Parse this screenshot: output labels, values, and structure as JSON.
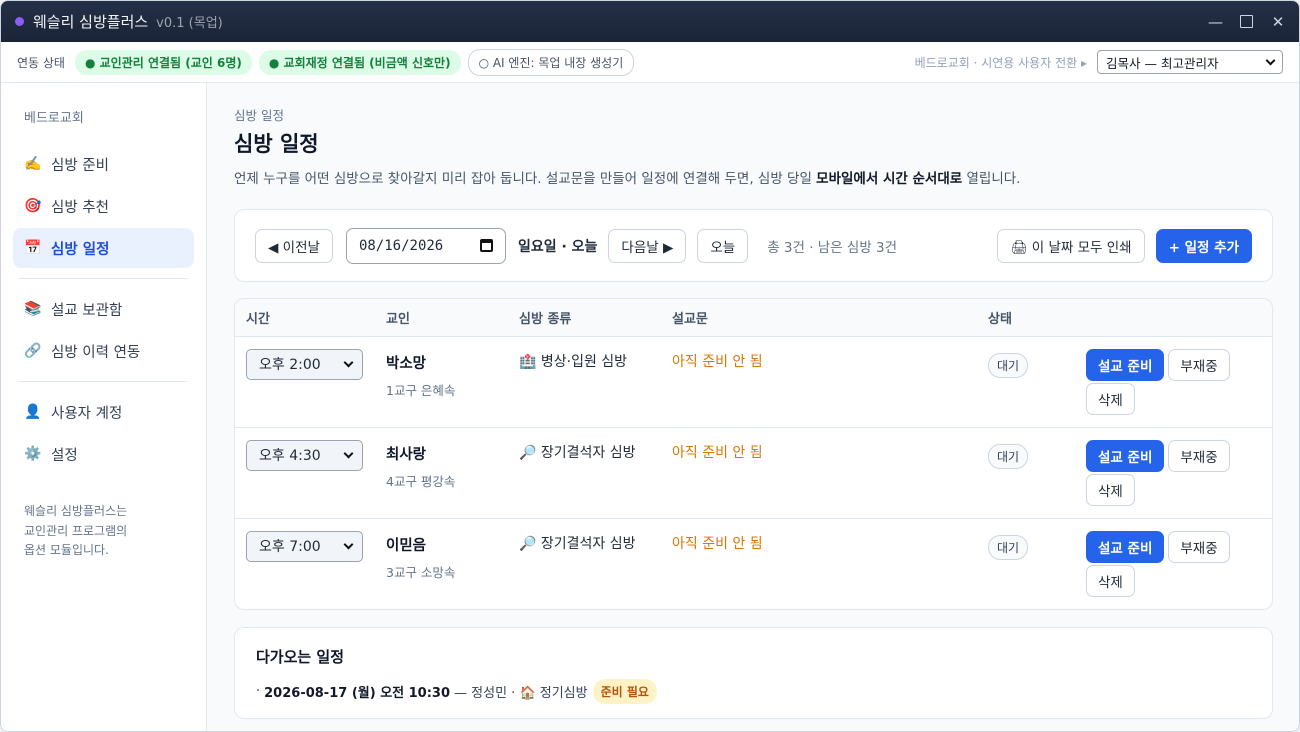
{
  "window": {
    "app_title": "웨슬리 심방플러스",
    "version": "v0.1 (목업)",
    "minimize": "—",
    "close": "✕"
  },
  "status": {
    "label": "연동 상태",
    "pills": [
      {
        "text": "● 교인관리 연결됨 (교인 6명)",
        "style": "green"
      },
      {
        "text": "● 교회재정 연결됨 (비금액 신호만)",
        "style": "green"
      },
      {
        "text": "○ AI 엔진: 목업 내장 생성기",
        "style": "grey"
      }
    ],
    "right_text": "베드로교회 · 시연용 사용자 전환 ▸",
    "user_value": "김목사 — 최고관리자"
  },
  "sidebar": {
    "church": "베드로교회",
    "items": [
      {
        "icon": "✍️",
        "label": "심방 준비"
      },
      {
        "icon": "🎯",
        "label": "심방 추천"
      },
      {
        "icon": "📅",
        "label": "심방 일정"
      },
      {
        "icon": "📚",
        "label": "설교 보관함"
      },
      {
        "icon": "🔗",
        "label": "심방 이력 연동"
      },
      {
        "icon": "👤",
        "label": "사용자 계정"
      },
      {
        "icon": "⚙️",
        "label": "설정"
      }
    ],
    "footer": [
      "웨슬리 심방플러스는",
      "교인관리 프로그램의",
      "옵션 모듈입니다."
    ]
  },
  "page": {
    "breadcrumb": "심방 일정",
    "title": "심방 일정",
    "desc_pre": "언제 누구를 어떤 심방으로 찾아갈지 미리 잡아 둡니다. 설교문을 만들어 일정에 연결해 두면, 심방 당일 ",
    "desc_bold": "모바일에서 시간 순서대로",
    "desc_post": " 열립니다."
  },
  "toolbar": {
    "prev": "◀ 이전날",
    "date": "08/16/2026",
    "day": "일요일 · 오늘",
    "next": "다음날 ▶",
    "today": "오늘",
    "count": "총 3건 · 남은 심방 3건",
    "print": "🖨 이 날짜 모두 인쇄",
    "add": "+ 일정 추가"
  },
  "table": {
    "headers": [
      "시간",
      "교인",
      "심방 종류",
      "설교문",
      "상태",
      ""
    ],
    "rows": [
      {
        "time": "오후 2:00",
        "name": "박소망",
        "group": "1교구 은혜속",
        "type": "🏥 병상·입원 심방",
        "sermon": "아직 준비 안 됨",
        "status": "대기"
      },
      {
        "time": "오후 4:30",
        "name": "최사랑",
        "group": "4교구 평강속",
        "type": "🔎 장기결석자 심방",
        "sermon": "아직 준비 안 됨",
        "status": "대기"
      },
      {
        "time": "오후 7:00",
        "name": "이믿음",
        "group": "3교구 소망속",
        "type": "🔎 장기결석자 심방",
        "sermon": "아직 준비 안 됨",
        "status": "대기"
      }
    ],
    "actions": {
      "prepare": "설교 준비",
      "absent": "부재중",
      "delete": "삭제"
    }
  },
  "upcoming": {
    "title": "다가오는 일정",
    "bullet": "·",
    "datetime": "2026-08-17 (월) 오전 10:30",
    "rest": "— 정성민 · 🏠 정기심방",
    "badge": "준비 필요"
  }
}
